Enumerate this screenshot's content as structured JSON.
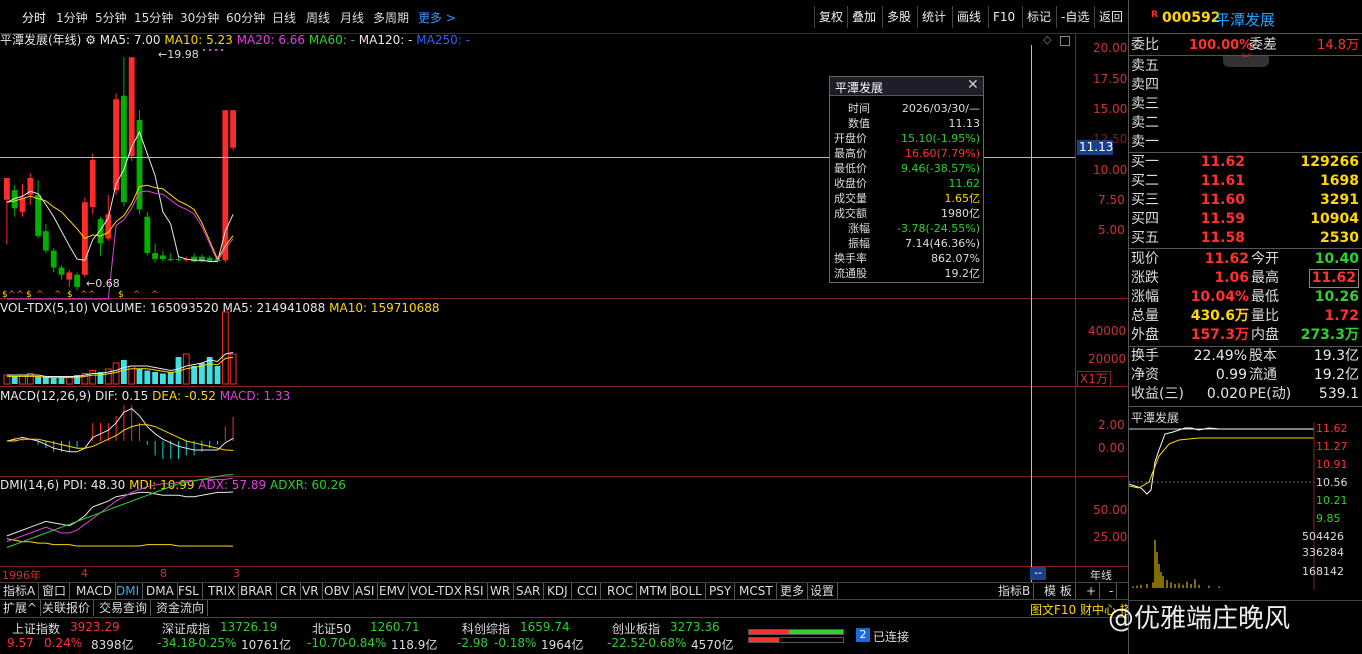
{
  "periods": [
    "分时",
    "1分钟",
    "5分钟",
    "15分钟",
    "30分钟",
    "60分钟",
    "日线",
    "周线",
    "月线",
    "多周期",
    "更多 >"
  ],
  "toolbar_right": [
    "复权",
    "叠加",
    "多股",
    "统计",
    "画线",
    "F10",
    "标记",
    "-自选",
    "返回"
  ],
  "legend_main": {
    "name": "平潭发展(年线)",
    "ma5": "MA5: 7.00",
    "ma10": "MA10: 5.23",
    "ma20": "MA20: 6.66",
    "ma60": "MA60: -",
    "ma120": "MA120: -",
    "ma250": "MA250: -"
  },
  "price_axis": [
    "20.00",
    "17.50",
    "15.00",
    "12.50",
    "10.00",
    "7.50",
    "5.00"
  ],
  "crosshair_price": "11.13",
  "high_label": "19.98",
  "low_label": "0.68",
  "legend_vol": {
    "name": "VOL-TDX(5,10)",
    "volume": "VOLUME: 165093520",
    "ma5": "MA5: 214941088",
    "ma10": "MA10: 159710688"
  },
  "vol_axis": [
    "40000",
    "20000"
  ],
  "vol_unit": "X1万",
  "legend_macd": {
    "name": "MACD(12,26,9)",
    "dif": "DIF: 0.15",
    "dea": "DEA: -0.52",
    "macd": "MACD: 1.33"
  },
  "macd_axis": [
    "2.00",
    "0.00"
  ],
  "legend_dmi": {
    "name": "DMI(14,6)",
    "pdi": "PDI: 48.30",
    "mdi": "MDI: 10.99",
    "adx": "ADX: 57.89",
    "adxr": "ADXR: 60.26"
  },
  "dmi_axis": [
    "50.00",
    "25.00"
  ],
  "xaxis": {
    "start": "1996年",
    "m1": "4",
    "m2": "8",
    "m3": "3",
    "period": "年线"
  },
  "indicator_tabs": [
    "指标A",
    "窗口",
    "MACD",
    "DMI",
    "DMA",
    "FSL",
    "TRIX",
    "BRAR",
    "CR",
    "VR",
    "OBV",
    "ASI",
    "EMV",
    "VOL-TDX",
    "RSI",
    "WR",
    "SAR",
    "KDJ",
    "CCI",
    "ROC",
    "MTM",
    "BOLL",
    "PSY",
    "MCST",
    "更多",
    "设置"
  ],
  "indicator_right": [
    "指标B",
    "模 板",
    "+",
    "-"
  ],
  "sub_tabs": [
    "扩展^",
    "关联报价",
    "交易查询",
    "资金流向"
  ],
  "status_bar": {
    "text": "图文F10 财中心 搭",
    "conn": "已连接",
    "conn_num": "2"
  },
  "indices": [
    {
      "name": "上证指数",
      "value": "3923.29",
      "chg": "9.57",
      "pct": "0.24%",
      "amt": "8398亿",
      "color": "#ff3030"
    },
    {
      "name": "深证成指",
      "value": "13726.19",
      "chg": "-34.18",
      "pct": "-0.25%",
      "amt": "10761亿",
      "color": "#2fd02f"
    },
    {
      "name": "北证50",
      "value": "1260.71",
      "chg": "-10.70",
      "pct": "-0.84%",
      "amt": "118.9亿",
      "color": "#2fd02f"
    },
    {
      "name": "科创综指",
      "value": "1659.74",
      "chg": "-2.98",
      "pct": "-0.18%",
      "amt": "1964亿",
      "color": "#2fd02f"
    },
    {
      "name": "创业板指",
      "value": "3273.36",
      "chg": "-22.52",
      "pct": "-0.68%",
      "amt": "4570亿",
      "color": "#2fd02f"
    }
  ],
  "watermark": "@优雅端庄晚风",
  "tooltip": {
    "title": "平潭发展",
    "rows": [
      {
        "k": "时间",
        "v": "2026/03/30/—",
        "c": "#ddd"
      },
      {
        "k": "数值",
        "v": "11.13",
        "c": "#ddd"
      },
      {
        "k": "开盘价",
        "v": "15.10(-1.95%)",
        "c": "#2fd02f"
      },
      {
        "k": "最高价",
        "v": "16.60(7.79%)",
        "c": "#ff3030"
      },
      {
        "k": "最低价",
        "v": "9.46(-38.57%)",
        "c": "#2fd02f"
      },
      {
        "k": "收盘价",
        "v": "11.62",
        "c": "#2fd02f"
      },
      {
        "k": "成交量",
        "v": "1.65亿",
        "c": "#ffd800"
      },
      {
        "k": "成交额",
        "v": "1980亿",
        "c": "#ddd"
      },
      {
        "k": "涨幅",
        "v": "-3.78(-24.55%)",
        "c": "#2fd02f"
      },
      {
        "k": "振幅",
        "v": "7.14(46.36%)",
        "c": "#ddd"
      },
      {
        "k": "换手率",
        "v": "862.07%",
        "c": "#ddd"
      },
      {
        "k": "流通股",
        "v": "19.2亿",
        "c": "#ddd"
      }
    ]
  },
  "stock": {
    "flag": "R",
    "code": "000592",
    "name": "平潭发展"
  },
  "order": {
    "wb_label": "委比",
    "wb": "100.00%",
    "wc_label": "委差",
    "wc": "14.8万"
  },
  "sells": [
    "卖五",
    "卖四",
    "卖三",
    "卖二",
    "卖一"
  ],
  "buys": [
    {
      "l": "买一",
      "p": "11.62",
      "v": "129266"
    },
    {
      "l": "买二",
      "p": "11.61",
      "v": "1698"
    },
    {
      "l": "买三",
      "p": "11.60",
      "v": "3291"
    },
    {
      "l": "买四",
      "p": "11.59",
      "v": "10904"
    },
    {
      "l": "买五",
      "p": "11.58",
      "v": "2530"
    }
  ],
  "quote": [
    {
      "l1": "现价",
      "v1": "11.62",
      "c1": "#ff3030",
      "l2": "今开",
      "v2": "10.40",
      "c2": "#2fd02f"
    },
    {
      "l1": "涨跌",
      "v1": "1.06",
      "c1": "#ff3030",
      "l2": "最高",
      "v2": "11.62",
      "c2": "#ff3030"
    },
    {
      "l1": "涨幅",
      "v1": "10.04%",
      "c1": "#ff3030",
      "l2": "最低",
      "v2": "10.26",
      "c2": "#2fd02f"
    },
    {
      "l1": "总量",
      "v1": "430.6万",
      "c1": "#ffd800",
      "l2": "量比",
      "v2": "1.72",
      "c2": "#ff3030"
    },
    {
      "l1": "外盘",
      "v1": "157.3万",
      "c1": "#ff3030",
      "l2": "内盘",
      "v2": "273.3万",
      "c2": "#2fd02f"
    }
  ],
  "stats": [
    {
      "l1": "换手",
      "v1": "22.49%",
      "l2": "股本",
      "v2": "19.3亿"
    },
    {
      "l1": "净资",
      "v1": "0.99",
      "l2": "流通",
      "v2": "19.2亿"
    },
    {
      "l1": "收益(三)",
      "v1": "0.020",
      "l2": "PE(动)",
      "v2": "539.1"
    }
  ],
  "mini": {
    "title": "平潭发展",
    "axis": [
      "11.62",
      "11.27",
      "10.91",
      "10.56",
      "10.21",
      "9.85"
    ],
    "vaxis": [
      "504426",
      "336284",
      "168142"
    ]
  },
  "chart_data": {
    "type": "candlestick",
    "title": "平潭发展(年线)",
    "ylim": [
      0,
      21
    ],
    "candles": [
      {
        "o": 8.2,
        "c": 10,
        "h": 10,
        "l": 4.5,
        "up": true
      },
      {
        "o": 9.0,
        "c": 7.5,
        "h": 9.4,
        "l": 6.8,
        "up": false
      },
      {
        "o": 7.2,
        "c": 8.4,
        "h": 9.5,
        "l": 6.8,
        "up": true
      },
      {
        "o": 8.6,
        "c": 10.0,
        "h": 10.4,
        "l": 7.8,
        "up": true
      },
      {
        "o": 8.6,
        "c": 5.2,
        "h": 9.8,
        "l": 5.0,
        "up": false
      },
      {
        "o": 5.6,
        "c": 4.0,
        "h": 6.2,
        "l": 3.8,
        "up": false
      },
      {
        "o": 4.0,
        "c": 2.6,
        "h": 4.2,
        "l": 2.2,
        "up": false
      },
      {
        "o": 2.6,
        "c": 2.0,
        "h": 2.8,
        "l": 1.6,
        "up": false
      },
      {
        "o": 1.6,
        "c": 2.2,
        "h": 2.4,
        "l": 1.0,
        "up": true
      },
      {
        "o": 2.0,
        "c": 1.0,
        "h": 2.2,
        "l": 0.68,
        "up": false
      },
      {
        "o": 2.0,
        "c": 8.0,
        "h": 8.4,
        "l": 1.8,
        "up": true
      },
      {
        "o": 7.6,
        "c": 11.5,
        "h": 12.0,
        "l": 7.0,
        "up": true
      },
      {
        "o": 6.6,
        "c": 4.6,
        "h": 6.8,
        "l": 3.6,
        "up": false
      },
      {
        "o": 5.0,
        "c": 7.0,
        "h": 8.6,
        "l": 4.8,
        "up": true
      },
      {
        "o": 9.0,
        "c": 16.5,
        "h": 17.0,
        "l": 8.6,
        "up": true
      },
      {
        "o": 16.8,
        "c": 8.0,
        "h": 19.98,
        "l": 7.6,
        "up": false
      },
      {
        "o": 11.8,
        "c": 19.98,
        "h": 19.98,
        "l": 11.4,
        "up": true
      },
      {
        "o": 14.8,
        "c": 7.4,
        "h": 15.6,
        "l": 7.0,
        "up": false
      },
      {
        "o": 6.8,
        "c": 3.8,
        "h": 7.2,
        "l": 3.6,
        "up": false
      },
      {
        "o": 3.8,
        "c": 3.3,
        "h": 4.6,
        "l": 3.0,
        "up": false
      },
      {
        "o": 3.6,
        "c": 3.3,
        "h": 4.0,
        "l": 3.1,
        "up": false
      },
      {
        "o": 3.3,
        "c": 3.3,
        "h": 3.8,
        "l": 3.1,
        "up": false
      },
      {
        "o": 3.3,
        "c": 3.3,
        "h": 3.6,
        "l": 3.1,
        "up": false
      },
      {
        "o": 3.2,
        "c": 3.3,
        "h": 3.5,
        "l": 3.1,
        "up": true
      },
      {
        "o": 3.5,
        "c": 3.1,
        "h": 3.8,
        "l": 3.0,
        "up": false
      },
      {
        "o": 3.5,
        "c": 3.1,
        "h": 3.7,
        "l": 3.0,
        "up": false
      },
      {
        "o": 3.4,
        "c": 3.1,
        "h": 3.6,
        "l": 3.0,
        "up": false
      },
      {
        "o": 3.3,
        "c": 3.1,
        "h": 3.5,
        "l": 3.0,
        "up": false
      },
      {
        "o": 3.2,
        "c": 15.6,
        "h": 15.6,
        "l": 3.0,
        "up": true
      },
      {
        "o": 15.6,
        "c": 12.5,
        "h": 15.6,
        "l": 12.3,
        "up": true
      }
    ],
    "ma5": [
      8,
      8.3,
      8.5,
      8.9,
      8.7,
      7.8,
      6.8,
      5.6,
      4.4,
      3.3,
      3.2,
      4.9,
      5.7,
      6.7,
      9.5,
      10.7,
      12.6,
      13.8,
      12.0,
      10.2,
      7.2,
      6.2,
      3.5,
      3.3,
      3.2,
      3.2,
      3.1,
      3.1,
      5.6,
      7.0
    ],
    "ma10": [
      8,
      8.1,
      8.3,
      8.5,
      8.3,
      8.1,
      7.6,
      7.2,
      6.5,
      5.8,
      5.0,
      5.3,
      5.2,
      5.5,
      6.4,
      6.9,
      7.9,
      9.3,
      9.4,
      9.2,
      9.1,
      8.6,
      8.1,
      7.8,
      7.4,
      6.3,
      4.8,
      3.3,
      4.4,
      5.23
    ],
    "vol": [
      6,
      5,
      6,
      7,
      5,
      5,
      4,
      5,
      5,
      6,
      7,
      9,
      8,
      10,
      14,
      16,
      12,
      10,
      9,
      8,
      7,
      8,
      18,
      20,
      12,
      14,
      18,
      12,
      48,
      20
    ],
    "vol_ma": [
      6,
      6,
      6,
      6,
      6,
      5,
      5,
      5,
      5,
      5,
      6,
      7,
      7,
      8,
      9,
      11,
      12,
      12,
      12,
      11,
      10,
      9,
      10,
      12,
      13,
      14,
      16,
      15,
      20,
      21
    ],
    "dif": [
      0,
      0.1,
      0.2,
      0.1,
      0,
      -0.2,
      -0.4,
      -0.5,
      -0.6,
      -0.6,
      -0.4,
      0.2,
      0.4,
      0.6,
      1.0,
      1.6,
      1.8,
      1.4,
      0.8,
      0.4,
      0.1,
      -0.1,
      -0.3,
      -0.4,
      -0.5,
      -0.5,
      -0.5,
      -0.5,
      -0.1,
      0.15
    ],
    "dea": [
      0,
      0,
      0.1,
      0.1,
      0.1,
      0,
      -0.1,
      -0.2,
      -0.3,
      -0.4,
      -0.4,
      -0.3,
      -0.1,
      0.1,
      0.3,
      0.6,
      0.8,
      0.9,
      0.9,
      0.8,
      0.6,
      0.4,
      0.2,
      0,
      -0.1,
      -0.2,
      -0.3,
      -0.4,
      -0.5,
      -0.52
    ],
    "pdi": [
      18,
      20,
      22,
      24,
      26,
      28,
      27,
      26,
      25,
      28,
      32,
      38,
      40,
      42,
      45,
      46,
      47,
      48,
      48,
      47,
      46,
      46,
      46,
      45,
      45,
      46,
      47,
      48,
      48,
      48.3
    ],
    "mdi": [
      16,
      15,
      14,
      14,
      13,
      13,
      12,
      12,
      12,
      11,
      11,
      11,
      11,
      11,
      11,
      11,
      11,
      11,
      12,
      12,
      12,
      12,
      11,
      11,
      11,
      11,
      11,
      11,
      11,
      10.99
    ],
    "adx": [
      14,
      16,
      18,
      20,
      22,
      24,
      22,
      20,
      20,
      22,
      26,
      30,
      34,
      38,
      42,
      45,
      48,
      50,
      52,
      53,
      54,
      54,
      55,
      56,
      56,
      57,
      57,
      57,
      57,
      57.89
    ],
    "adxr": [
      10,
      12,
      14,
      16,
      18,
      20,
      22,
      24,
      26,
      28,
      30,
      32,
      34,
      36,
      38,
      40,
      42,
      44,
      46,
      48,
      50,
      52,
      54,
      55,
      56,
      57,
      58,
      59,
      60,
      60.26
    ]
  }
}
